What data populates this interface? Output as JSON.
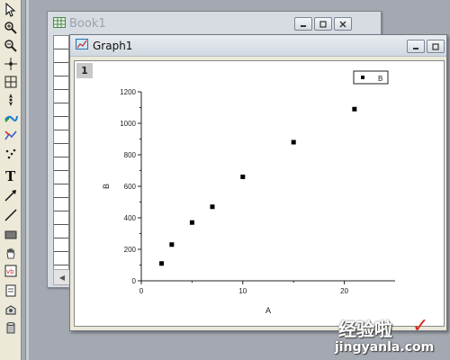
{
  "book": {
    "title": "Book1"
  },
  "graph": {
    "title": "Graph1",
    "layer_number": "1"
  },
  "chart_data": {
    "type": "scatter",
    "x": [
      2,
      3,
      5,
      7,
      10,
      15,
      21
    ],
    "y": [
      110,
      230,
      370,
      470,
      660,
      880,
      1090
    ],
    "xlim": [
      0,
      25
    ],
    "ylim": [
      0,
      1200
    ],
    "xticks": [
      0,
      10,
      20
    ],
    "yticks": [
      0,
      200,
      400,
      600,
      800,
      1000,
      1200
    ],
    "xlabel": "A",
    "ylabel": "B",
    "legend": {
      "label": "B",
      "position": "top-right"
    },
    "marker": "square",
    "marker_color": "#000000"
  },
  "toolbar": {
    "tools": [
      "pointer-icon",
      "zoom-in-icon",
      "zoom-out-icon",
      "screen-reader-icon",
      "data-reader-icon",
      "data-selector-icon",
      "draw-data-icon",
      "mask-icon",
      "region-icon",
      "text-icon",
      "arrow-icon",
      "line-icon",
      "rectangle-icon",
      "hand-icon",
      "script-icon",
      "note-icon",
      "layer-icon",
      "cylinder-icon"
    ]
  },
  "watermark": {
    "text": "经验啦",
    "check": "✓",
    "url": "jingyanla.com"
  }
}
